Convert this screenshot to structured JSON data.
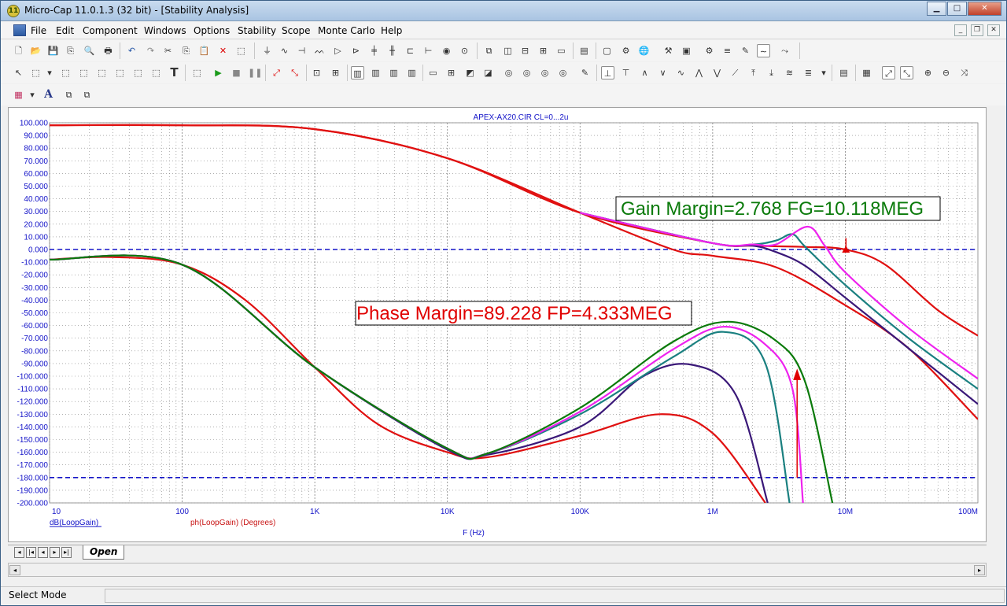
{
  "window": {
    "title": "Micro-Cap 11.0.1.3 (32 bit) - [Stability Analysis]",
    "app_icon_glyph": "11"
  },
  "menu": [
    "File",
    "Edit",
    "Component",
    "Windows",
    "Options",
    "Stability",
    "Scope",
    "Monte Carlo",
    "Help"
  ],
  "tabs": {
    "active": "Open"
  },
  "status": {
    "mode": "Select Mode"
  },
  "plot": {
    "title": "APEX-AX20.CIR CL=0...2u",
    "x_label": "F (Hz)",
    "legend": [
      {
        "label": "dB(LoopGain)",
        "color": "#1414c8"
      },
      {
        "label": "ph(LoopGain) (Degrees)",
        "color": "#c81414"
      }
    ],
    "gain_margin_label": "Gain Margin=2.768 FG=10.118MEG",
    "phase_margin_label": "Phase Margin=89.228 FP=4.333MEG",
    "gain_margin_color": "#0a7a0a",
    "phase_margin_color": "#e00000"
  },
  "chart_data": {
    "type": "line",
    "title": "APEX-AX20.CIR CL=0...2u",
    "xlabel": "F (Hz)",
    "ylabel": "",
    "x_scale": "log",
    "xlim": [
      10,
      100000000
    ],
    "ylim": [
      -200,
      100
    ],
    "x_ticks": [
      "10",
      "100",
      "1K",
      "10K",
      "100K",
      "1M",
      "10M",
      "100M"
    ],
    "y_ticks": [
      "100.000",
      "90.000",
      "80.000",
      "70.000",
      "60.000",
      "50.000",
      "40.000",
      "30.000",
      "20.000",
      "10.000",
      "0.000",
      "-10.000",
      "-20.000",
      "-30.000",
      "-40.000",
      "-50.000",
      "-60.000",
      "-70.000",
      "-80.000",
      "-90.000",
      "-100.000",
      "-110.000",
      "-120.000",
      "-130.000",
      "-140.000",
      "-150.000",
      "-160.000",
      "-170.000",
      "-180.000",
      "-190.000",
      "-200.000"
    ],
    "reference_lines": [
      0,
      -180
    ],
    "grid": true,
    "annotations": [
      "Gain Margin=2.768 FG=10.118MEG",
      "Phase Margin=89.228 FP=4.333MEG"
    ],
    "series": [
      {
        "color": "#e01010",
        "x": [
          10,
          100,
          1000,
          10000,
          100000,
          1000000,
          2000000,
          5000000,
          10000000,
          20000000,
          50000000,
          100000000
        ],
        "values": [
          98,
          98,
          95,
          72,
          29,
          5,
          3,
          2,
          0,
          -12,
          -48,
          -68
        ]
      },
      {
        "color": "#e01010",
        "x": [
          10,
          100,
          1000,
          10000,
          100000,
          500000,
          1000000,
          3000000,
          10000000,
          30000000,
          100000000
        ],
        "values": [
          98,
          98,
          95,
          72,
          29,
          0,
          -5,
          -14,
          -44,
          -78,
          -134
        ]
      },
      {
        "color": "#3a1878",
        "x": [
          100000,
          1000000,
          2000000,
          3000000,
          5000000,
          10000000,
          30000000,
          100000000
        ],
        "values": [
          29,
          5,
          3,
          -2,
          -13,
          -38,
          -78,
          -122
        ]
      },
      {
        "color": "#1a8080",
        "x": [
          100000,
          1000000,
          2000000,
          3000000,
          4000000,
          5000000,
          10000000,
          30000000,
          100000000
        ],
        "values": [
          29,
          5,
          4,
          7,
          12,
          2,
          -28,
          -70,
          -110
        ]
      },
      {
        "color": "#ee22ee",
        "x": [
          100000,
          1000000,
          2000000,
          3000000,
          5200000,
          7000000,
          10000000,
          30000000,
          100000000
        ],
        "values": [
          29,
          5,
          4,
          4,
          18,
          3,
          -18,
          -62,
          -102
        ]
      },
      {
        "color": "#e01010",
        "x": [
          10,
          30,
          100,
          300,
          1000,
          3000,
          10000,
          20000,
          100000,
          400000,
          1000000,
          2500000
        ],
        "values": [
          -8,
          -6,
          -12,
          -40,
          -93,
          -138,
          -160,
          -164,
          -147,
          -130,
          -145,
          -200
        ]
      },
      {
        "color": "#3a1878",
        "x": [
          10,
          100,
          1000,
          10000,
          20000,
          100000,
          300000,
          700000,
          1500000,
          2600000
        ],
        "values": [
          -8,
          -12,
          -93,
          -158,
          -162,
          -140,
          -100,
          -91,
          -115,
          -200
        ]
      },
      {
        "color": "#1a8080",
        "x": [
          10,
          100,
          1000,
          10000,
          20000,
          100000,
          500000,
          1200000,
          2500000,
          3800000
        ],
        "values": [
          -8,
          -12,
          -93,
          -157,
          -161,
          -130,
          -85,
          -65,
          -90,
          -200
        ]
      },
      {
        "color": "#ee22ee",
        "x": [
          10,
          100,
          1000,
          10000,
          20000,
          100000,
          500000,
          1200000,
          2500000,
          4000000,
          4800000
        ],
        "values": [
          -8,
          -12,
          -93,
          -157,
          -161,
          -128,
          -79,
          -61,
          -75,
          -110,
          -200
        ]
      },
      {
        "color": "#0a7a0a",
        "x": [
          10,
          100,
          1000,
          10000,
          20000,
          100000,
          500000,
          1300000,
          3000000,
          5000000,
          8000000
        ],
        "values": [
          -8,
          -12,
          -93,
          -157,
          -161,
          -125,
          -73,
          -57,
          -72,
          -105,
          -200
        ]
      }
    ]
  }
}
